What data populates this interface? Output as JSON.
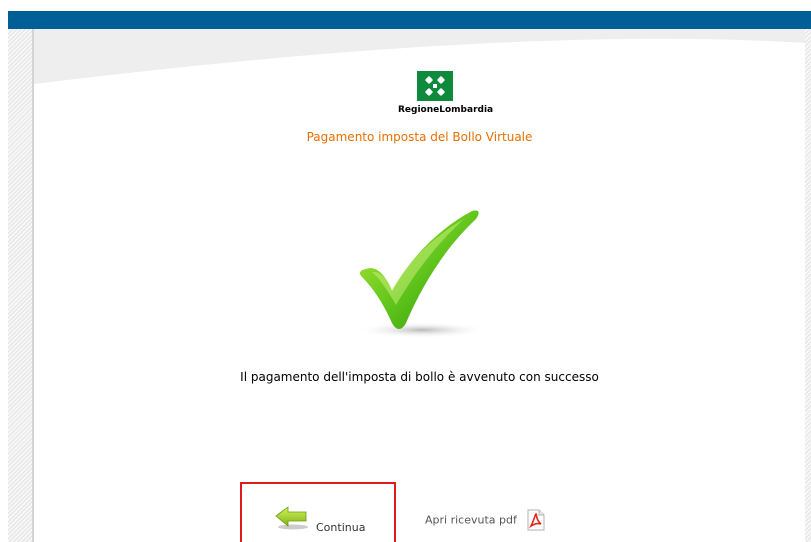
{
  "header": {
    "logo_text": "RegioneLombardia",
    "subtitle": "Pagamento imposta del Bollo Virtuale"
  },
  "main": {
    "status_icon": "checkmark-icon",
    "message": "Il pagamento dell'imposta di bollo è avvenuto con successo"
  },
  "actions": {
    "continue_label": "Continua",
    "continue_icon": "back-arrow-icon",
    "pdf_label": "Apri ricevuta pdf",
    "pdf_icon": "pdf-icon"
  },
  "colors": {
    "top_bar": "#005f96",
    "subtitle": "#e86f00",
    "logo_green": "#0d8a3b",
    "highlight_border": "#e01a1a"
  }
}
